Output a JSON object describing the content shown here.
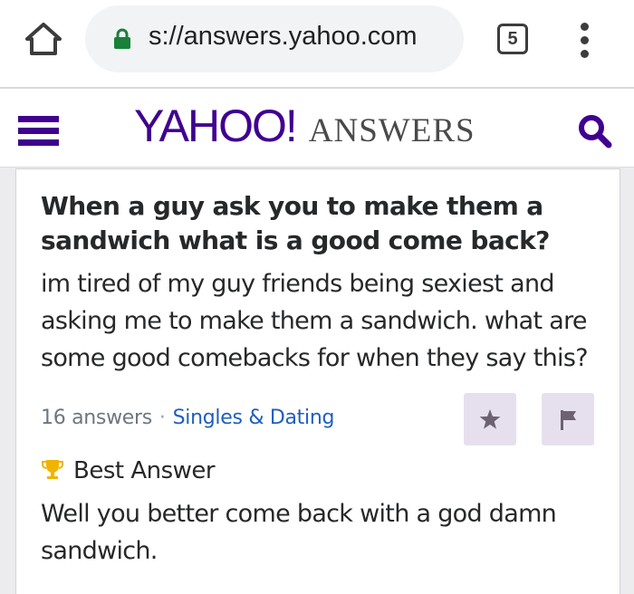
{
  "browser": {
    "url": "s://answers.yahoo.com",
    "tab_count": "5",
    "icons": {
      "home": "home-icon",
      "lock": "lock-icon",
      "menu": "more-vert-icon"
    },
    "lock_color": "#188038"
  },
  "header": {
    "logo_main": "YAHOO!",
    "logo_sub": "ANSWERS",
    "brand_color": "#400090",
    "icons": {
      "menu": "hamburger-icon",
      "search": "search-icon"
    }
  },
  "question": {
    "title": "When a guy ask you to make them a sandwich what is a good come back?",
    "body": "im tired of my guy friends being sexiest and asking me to make them a sandwich. what are some good comebacks for when they say this?",
    "answer_count": "16 answers",
    "separator": "·",
    "category": "Singles & Dating",
    "actions": {
      "star": "star-icon",
      "flag": "flag-icon"
    }
  },
  "best_answer": {
    "label": "Best Answer",
    "text": "Well you better come back with a god damn sandwich.",
    "icon": "trophy-icon",
    "icon_color": "#f0b400"
  }
}
